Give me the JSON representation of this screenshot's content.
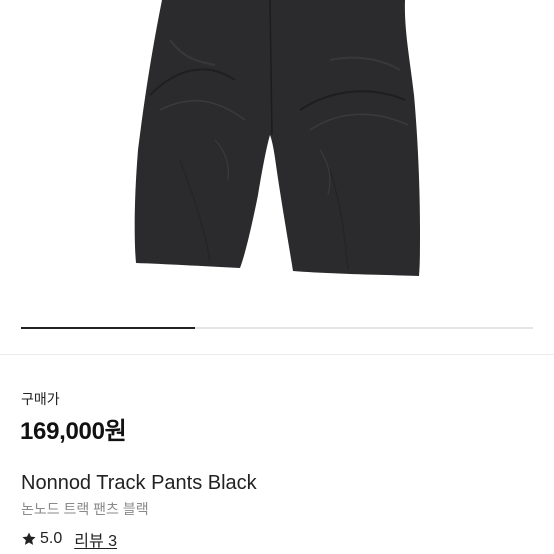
{
  "product": {
    "price_label": "구매가",
    "price": "169,000원",
    "name_en": "Nonnod Track Pants Black",
    "name_ko": "논노드 트랙 팬츠 블랙",
    "rating": "5.0",
    "review_link": "리뷰 3",
    "image_subject": "black-track-pants-photo"
  },
  "carousel": {
    "progress": 0.34
  },
  "colors": {
    "product": "#2a2a2c",
    "accent": "#222222",
    "secondary_text": "#8a8a8a"
  }
}
